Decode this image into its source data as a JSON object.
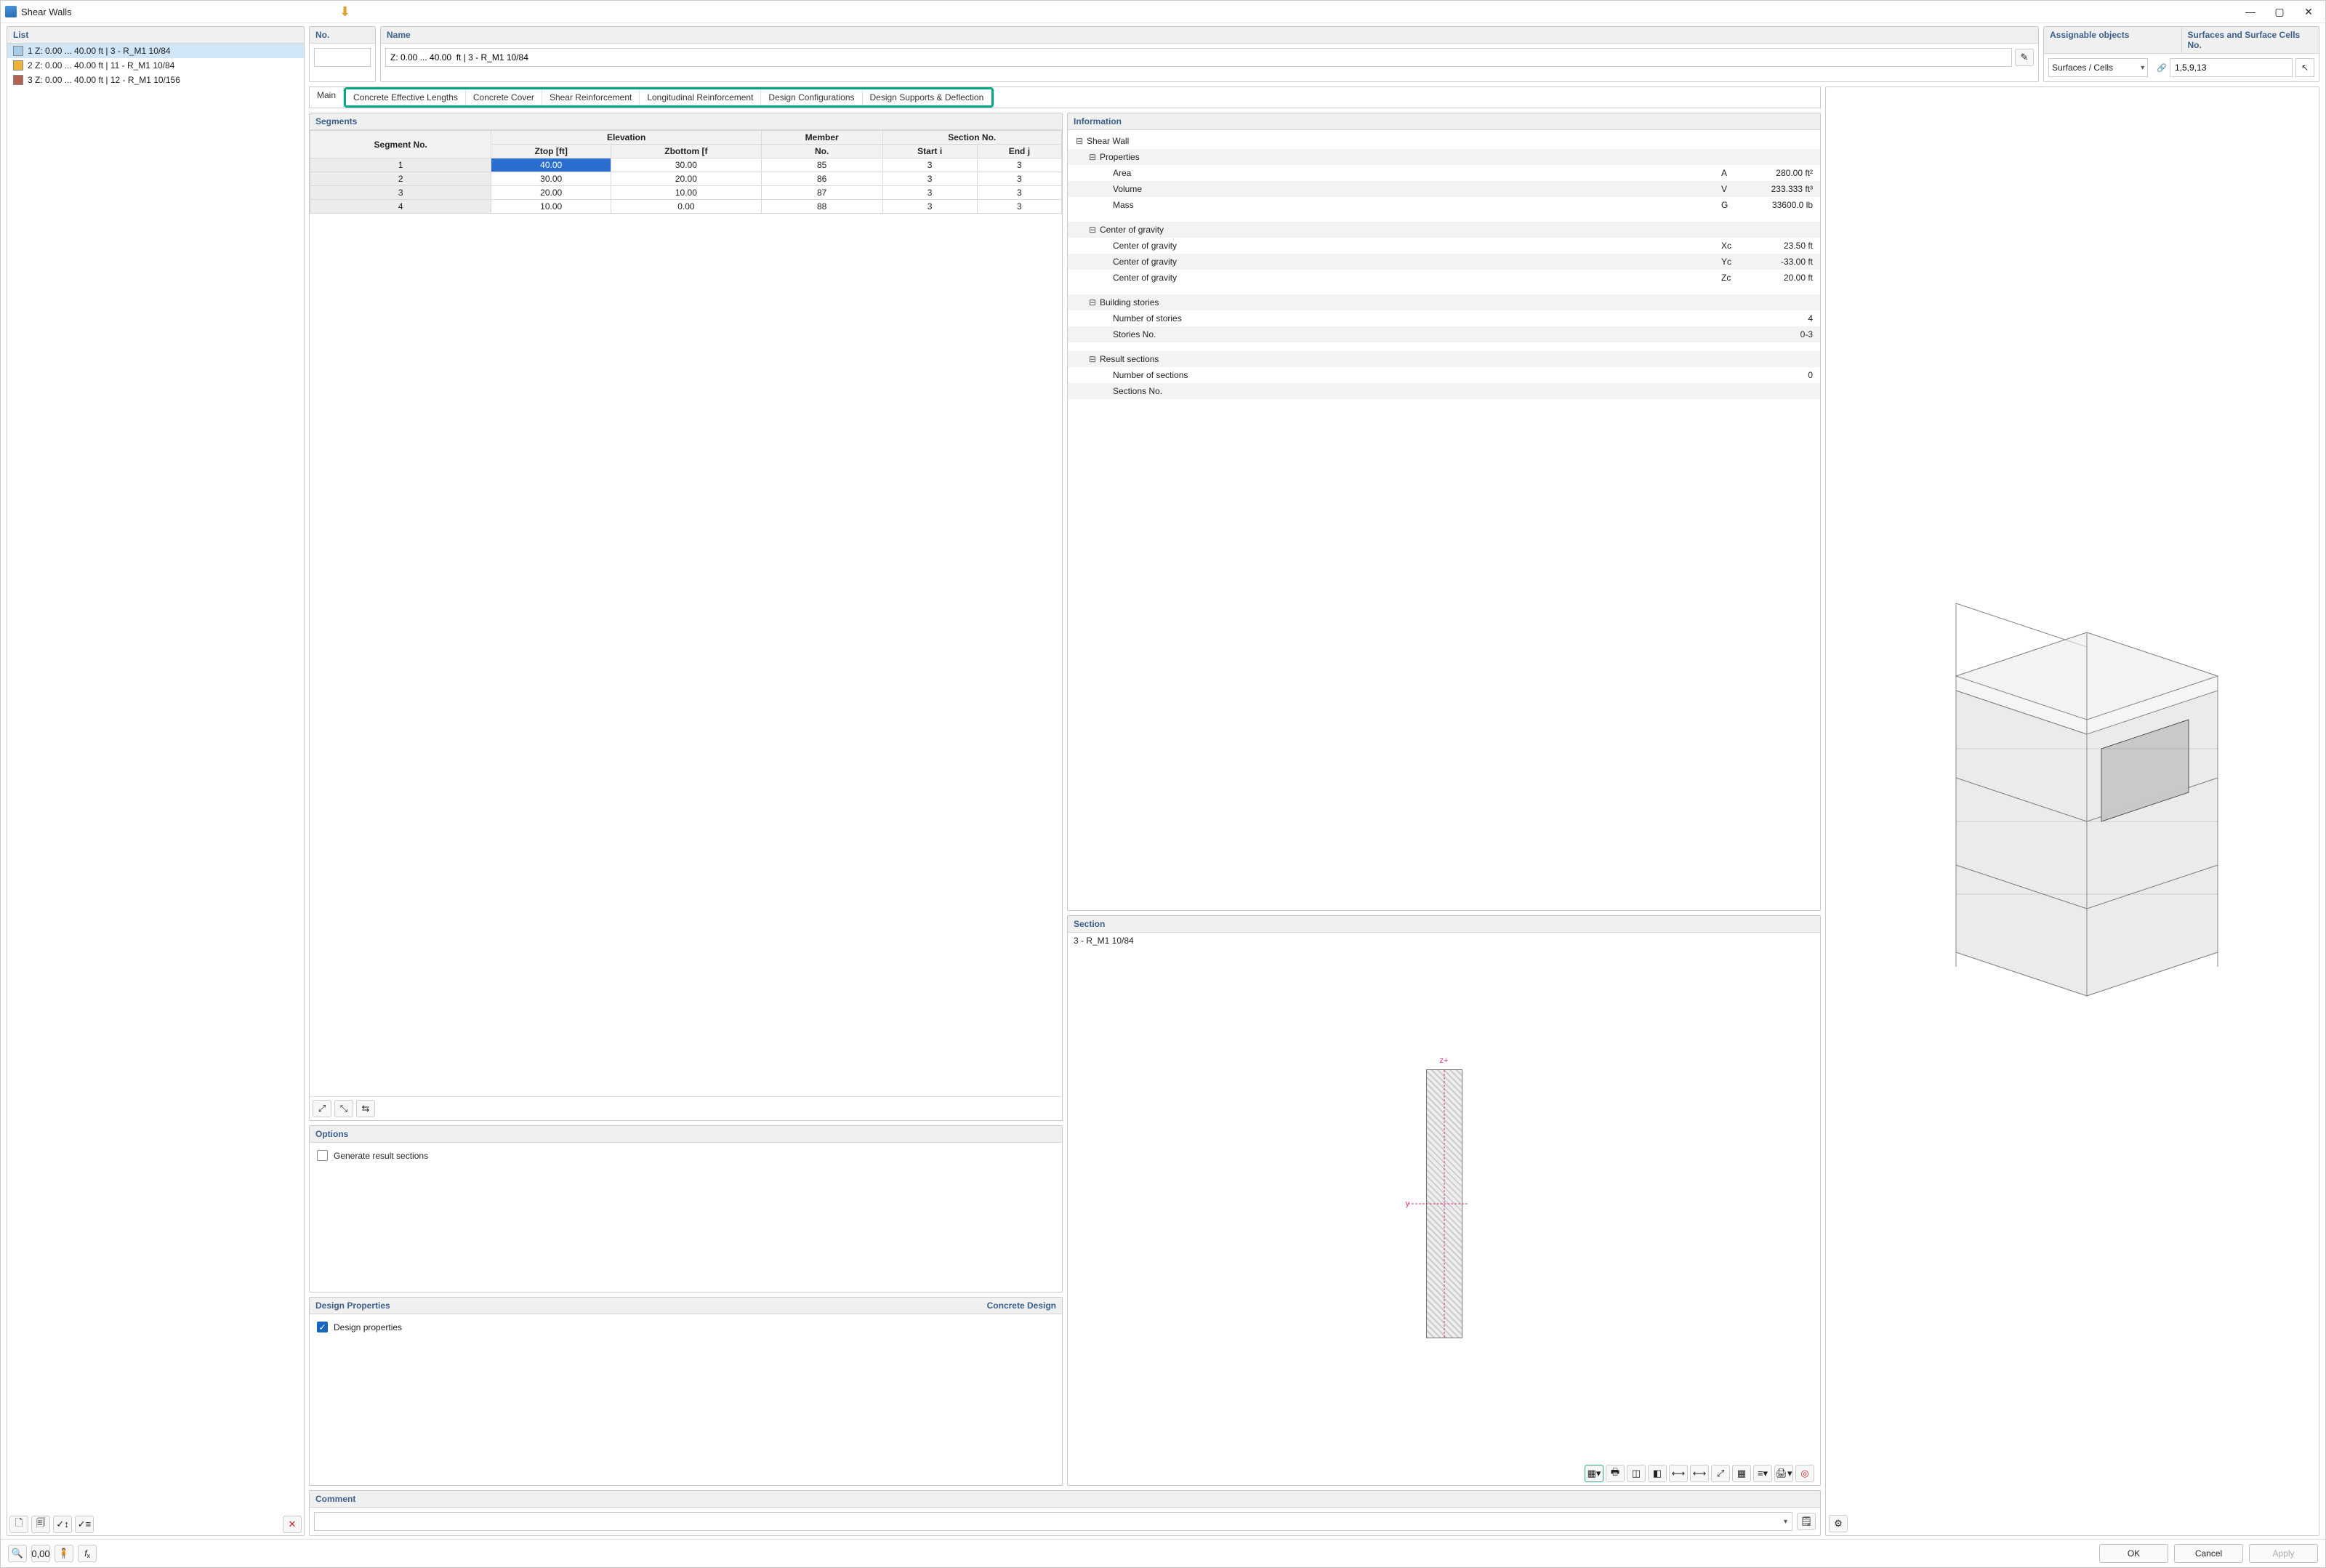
{
  "window": {
    "title": "Shear Walls"
  },
  "list": {
    "header": "List",
    "items": [
      {
        "color": "#a8cbe8",
        "label": "1 Z: 0.00 ... 40.00 ft | 3 - R_M1 10/84"
      },
      {
        "color": "#f0b138",
        "label": "2 Z: 0.00 ... 40.00 ft | 11 - R_M1 10/84"
      },
      {
        "color": "#b36250",
        "label": "3 Z: 0.00 ... 40.00 ft | 12 - R_M1 10/156"
      }
    ]
  },
  "no": {
    "header": "No.",
    "value": ""
  },
  "name": {
    "header": "Name",
    "value": "Z: 0.00 ... 40.00  ft | 3 - R_M1 10/84"
  },
  "assignable": {
    "header": "Assignable objects",
    "selected": "Surfaces / Cells"
  },
  "surfaces": {
    "header": "Surfaces and Surface Cells No.",
    "value": "1,5,9,13"
  },
  "tabs": {
    "main": "Main",
    "others": [
      "Concrete Effective Lengths",
      "Concrete Cover",
      "Shear Reinforcement",
      "Longitudinal Reinforcement",
      "Design Configurations",
      "Design Supports & Deflection"
    ]
  },
  "segments": {
    "header": "Segments",
    "columns": {
      "seg": "Segment No.",
      "elev": "Elevation",
      "ztop": "Ztop [ft]",
      "zbot": "Zbottom [f",
      "member": "Member",
      "mno": "No.",
      "section": "Section No.",
      "start": "Start i",
      "end": "End j"
    },
    "rows": [
      {
        "no": "1",
        "ztop": "40.00",
        "zbot": "30.00",
        "mno": "85",
        "start": "3",
        "end": "3",
        "hl": true
      },
      {
        "no": "2",
        "ztop": "30.00",
        "zbot": "20.00",
        "mno": "86",
        "start": "3",
        "end": "3"
      },
      {
        "no": "3",
        "ztop": "20.00",
        "zbot": "10.00",
        "mno": "87",
        "start": "3",
        "end": "3"
      },
      {
        "no": "4",
        "ztop": "10.00",
        "zbot": "0.00",
        "mno": "88",
        "start": "3",
        "end": "3"
      }
    ]
  },
  "options": {
    "header": "Options",
    "generate": "Generate result sections"
  },
  "design": {
    "header": "Design Properties",
    "right": "Concrete Design",
    "check": "Design properties"
  },
  "info": {
    "header": "Information",
    "shearwall": "Shear Wall",
    "properties": "Properties",
    "area_l": "Area",
    "area_s": "A",
    "area_v": "280.00 ft²",
    "vol_l": "Volume",
    "vol_s": "V",
    "vol_v": "233.333 ft³",
    "mass_l": "Mass",
    "mass_s": "G",
    "mass_v": "33600.0 lb",
    "cg": "Center of gravity",
    "cgx_l": "Center of gravity",
    "cgx_s": "Xc",
    "cgx_v": "23.50 ft",
    "cgy_l": "Center of gravity",
    "cgy_s": "Yc",
    "cgy_v": "-33.00 ft",
    "cgz_l": "Center of gravity",
    "cgz_s": "Zc",
    "cgz_v": "20.00 ft",
    "bs": "Building stories",
    "ns_l": "Number of stories",
    "ns_v": "4",
    "sn_l": "Stories No.",
    "sn_v": "0-3",
    "rs": "Result sections",
    "nrs_l": "Number of sections",
    "nrs_v": "0",
    "secno_l": "Sections No."
  },
  "section": {
    "header": "Section",
    "name": "3 - R_M1 10/84",
    "z": "z+",
    "y": "y"
  },
  "comment": {
    "header": "Comment"
  },
  "buttons": {
    "ok": "OK",
    "cancel": "Cancel",
    "apply": "Apply"
  }
}
